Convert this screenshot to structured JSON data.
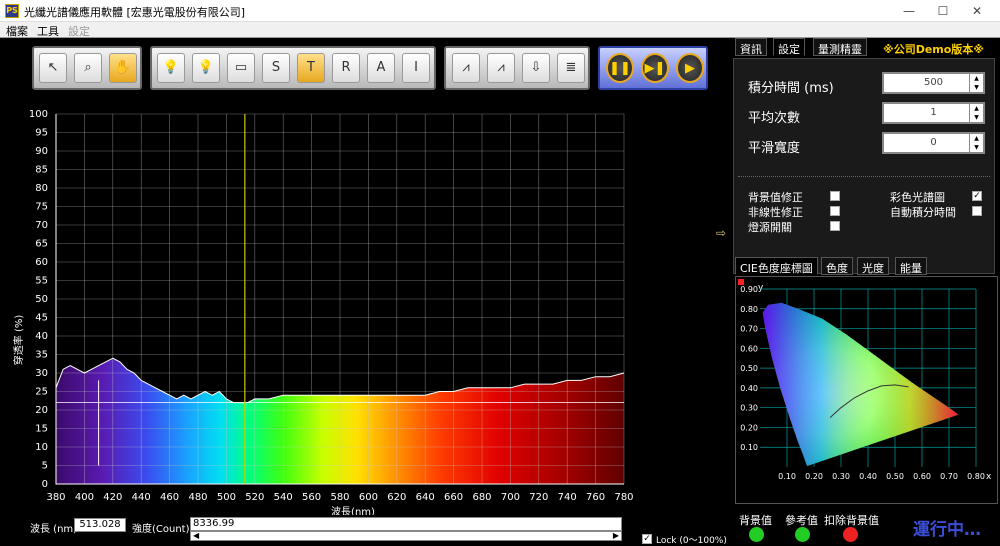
{
  "window": {
    "title": "光纖光譜儀應用軟體 [宏惠光電股份有限公司]",
    "app_icon_text": "PS",
    "controls": [
      "—",
      "☐",
      "✕"
    ]
  },
  "menu": {
    "items": [
      {
        "label": "檔案",
        "enabled": true
      },
      {
        "label": "工具",
        "enabled": true
      },
      {
        "label": "設定",
        "enabled": false
      }
    ]
  },
  "toolbar": {
    "group1": [
      {
        "icon": "cursor-arrow-icon",
        "glyph": "↖",
        "active": false
      },
      {
        "icon": "zoom-icon",
        "glyph": "⌕",
        "active": false
      },
      {
        "icon": "pan-hand-icon",
        "glyph": "✋",
        "active": true
      }
    ],
    "group2": [
      {
        "icon": "lamp-off-icon",
        "glyph": "💡",
        "active": false
      },
      {
        "icon": "lamp-on-icon",
        "glyph": "💡",
        "active": false
      },
      {
        "icon": "dark-reference-icon",
        "glyph": "▭",
        "active": false
      },
      {
        "icon": "scope-s-icon",
        "glyph": "S",
        "active": false
      },
      {
        "icon": "transmission-t-icon",
        "glyph": "T",
        "active": true
      },
      {
        "icon": "reflection-r-icon",
        "glyph": "R",
        "active": false
      },
      {
        "icon": "absorbance-a-icon",
        "glyph": "A",
        "active": false
      },
      {
        "icon": "irradiance-i-icon",
        "glyph": "I",
        "active": false
      }
    ],
    "group3": [
      {
        "icon": "graph-view-1-icon",
        "glyph": "⩘",
        "active": false
      },
      {
        "icon": "graph-view-2-icon",
        "glyph": "⩘",
        "active": false
      },
      {
        "icon": "save-download-icon",
        "glyph": "⇩",
        "active": false
      },
      {
        "icon": "export-layers-icon",
        "glyph": "≣",
        "active": false
      }
    ],
    "group4": [
      {
        "icon": "pause-icon",
        "glyph": "❚❚"
      },
      {
        "icon": "step-forward-icon",
        "glyph": "▶❚"
      },
      {
        "icon": "play-icon",
        "glyph": "▶"
      }
    ]
  },
  "chart_data": {
    "type": "line",
    "title": "",
    "xlabel": "波長(nm)",
    "ylabel": "穿透率 (%)",
    "xlim": [
      380,
      780
    ],
    "ylim": [
      0,
      100
    ],
    "xticks": [
      380,
      400,
      420,
      440,
      460,
      480,
      500,
      520,
      540,
      560,
      580,
      600,
      620,
      640,
      660,
      680,
      700,
      720,
      740,
      760,
      780
    ],
    "yticks": [
      0,
      5,
      10,
      15,
      20,
      25,
      30,
      35,
      40,
      45,
      50,
      55,
      60,
      65,
      70,
      75,
      80,
      85,
      90,
      95,
      100
    ],
    "grid": true,
    "background": "visible spectrum gradient",
    "cursor_wavelength": 513,
    "reference_line_y": 22,
    "series": [
      {
        "color": "#ffffff",
        "x": [
          380,
          385,
          390,
          395,
          400,
          405,
          410,
          415,
          420,
          425,
          430,
          435,
          440,
          445,
          450,
          455,
          460,
          465,
          470,
          475,
          480,
          485,
          490,
          495,
          500,
          505,
          510,
          515,
          520,
          525,
          530,
          540,
          550,
          560,
          570,
          580,
          590,
          600,
          610,
          620,
          630,
          640,
          650,
          660,
          670,
          680,
          690,
          700,
          710,
          720,
          730,
          740,
          750,
          760,
          770,
          780
        ],
        "y": [
          26,
          31,
          32,
          31,
          30,
          31,
          32,
          33,
          34,
          33,
          31,
          30,
          28,
          27,
          26,
          25,
          24,
          23,
          24,
          23,
          24,
          25,
          24,
          25,
          23,
          22,
          22,
          22,
          23,
          23,
          23,
          24,
          24,
          24,
          24,
          24,
          24,
          24,
          24,
          24,
          24,
          24,
          25,
          25,
          26,
          26,
          26,
          26,
          27,
          27,
          27,
          28,
          28,
          29,
          29,
          30
        ]
      }
    ]
  },
  "readout": {
    "wavelength_label": "波長 (nm)",
    "wavelength_value": "513.028",
    "intensity_label": "強度(Count)",
    "intensity_value": "8336.99",
    "lock_label": "Lock (0～100%)",
    "lock_checked": true
  },
  "right_tabs": {
    "items": [
      {
        "label": "資訊",
        "active": false
      },
      {
        "label": "設定",
        "active": true
      },
      {
        "label": "量測精靈",
        "active": false
      }
    ],
    "demo_badge": "※公司Demo版本※"
  },
  "settings": {
    "integration_time_label": "積分時間 (ms)",
    "integration_time_value": "500",
    "average_label": "平均次數",
    "average_value": "1",
    "smoothing_label": "平滑寬度",
    "smoothing_value": "0",
    "checks_left": [
      {
        "label": "背景值修正",
        "checked": false
      },
      {
        "label": "非線性修正",
        "checked": false
      },
      {
        "label": "燈源開關",
        "checked": false
      }
    ],
    "checks_right": [
      {
        "label": "彩色光譜圖",
        "checked": true
      },
      {
        "label": "自動積分時間",
        "checked": false
      }
    ]
  },
  "bottom_tabs": {
    "items": [
      {
        "label": "CIE色度座標圖",
        "active": true
      },
      {
        "label": "色度",
        "active": false
      },
      {
        "label": "光度",
        "active": false
      },
      {
        "label": "能量",
        "active": false
      }
    ]
  },
  "cie_chart": {
    "type": "scatter",
    "xlabel": "x",
    "ylabel": "y",
    "xlim": [
      0,
      0.8
    ],
    "ylim": [
      0,
      0.9
    ],
    "xticks": [
      "0.10",
      "0.20",
      "0.30",
      "0.40",
      "0.50",
      "0.60",
      "0.70",
      "0.80"
    ],
    "yticks": [
      "0.10",
      "0.20",
      "0.30",
      "0.40",
      "0.50",
      "0.60",
      "0.70",
      "0.80",
      "0.90"
    ],
    "grid": true
  },
  "status": {
    "leds": [
      {
        "label": "背景值",
        "color": "#22cc22"
      },
      {
        "label": "參考值",
        "color": "#22cc22"
      },
      {
        "label": "扣除背景值",
        "color": "#ee2222"
      }
    ],
    "running_text": "運行中…",
    "side_arrow": "⇨"
  },
  "colors": {
    "grid": "#c8c8c8",
    "cursor": "#cccc00",
    "cie_grid": "#00a0a0",
    "running": "#3a4fd8"
  }
}
